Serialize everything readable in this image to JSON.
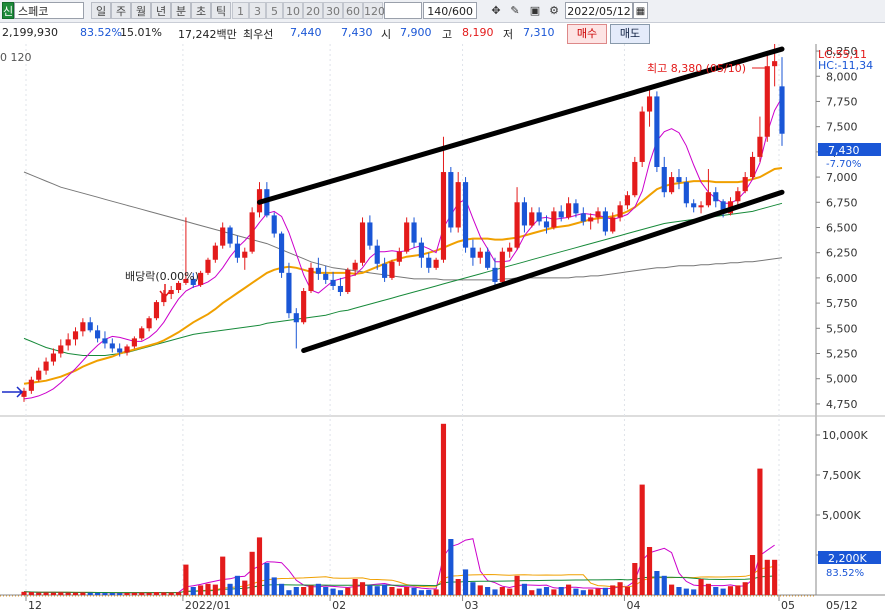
{
  "toolbar": {
    "market_badge": "신",
    "stock_name": "스페코",
    "periods": [
      "일",
      "주",
      "월",
      "년",
      "분",
      "초",
      "틱"
    ],
    "active_period": "일",
    "intervals": [
      "1",
      "3",
      "5",
      "10",
      "20",
      "30",
      "60",
      "120"
    ],
    "count_value": "140/600",
    "date_value": "2022/05/12"
  },
  "infobar": {
    "volume": "2,199,930",
    "volume_ratio": "83.52%",
    "turnover": "15.01%",
    "trade_value": "17,242백만",
    "best_bid_label": "최우선",
    "best_ask": "7,440",
    "best_bid": "7,430",
    "open_label": "시",
    "open": "7,900",
    "high_label": "고",
    "high": "8,190",
    "low_label": "저",
    "low": "7,310",
    "buy_label": "매수",
    "sell_label": "매도"
  },
  "chart": {
    "ma_legend": "0  120",
    "lc_label": "LC:55,11",
    "hc_label": "HC:-11,34",
    "high_annotation": "최고 8,380 (05/10)",
    "dividend_annotation": "배당락(0.00%)",
    "current_price_badge": "7,430",
    "current_change": "-7.70%",
    "volume_badge": "2,200K",
    "volume_ratio_badge": "83.52%",
    "price_ticks": [
      "8,250",
      "8,000",
      "7,750",
      "7,500",
      "7,250",
      "7,000",
      "6,750",
      "6,500",
      "6,250",
      "6,000",
      "5,750",
      "5,500",
      "5,250",
      "5,000",
      "4,750"
    ],
    "volume_ticks": [
      "10,000K",
      "7,500K",
      "5,000K",
      "2,500K"
    ],
    "date_labels": [
      "12",
      "2022/01",
      "02",
      "03",
      "04",
      "05",
      "05/12"
    ],
    "colors": {
      "up": "#e31b1b",
      "down": "#1a56d6",
      "ma5": "#cc00cc",
      "ma10": "#1a2cc8",
      "ma20": "#f0a000",
      "ma60": "#178a3a",
      "ma120": "#777777"
    }
  },
  "chart_data": {
    "type": "candlestick",
    "y_range": [
      4650,
      8320
    ],
    "volume_range": [
      0,
      11000
    ],
    "candles": [
      [
        4820,
        4910,
        4770,
        4880
      ],
      [
        4880,
        5020,
        4850,
        4990
      ],
      [
        4990,
        5110,
        4970,
        5080
      ],
      [
        5080,
        5210,
        5040,
        5170
      ],
      [
        5170,
        5300,
        5130,
        5250
      ],
      [
        5250,
        5390,
        5210,
        5330
      ],
      [
        5330,
        5450,
        5280,
        5390
      ],
      [
        5390,
        5510,
        5330,
        5470
      ],
      [
        5470,
        5600,
        5420,
        5560
      ],
      [
        5560,
        5610,
        5460,
        5480
      ],
      [
        5480,
        5530,
        5360,
        5400
      ],
      [
        5400,
        5470,
        5300,
        5350
      ],
      [
        5350,
        5400,
        5260,
        5300
      ],
      [
        5300,
        5350,
        5220,
        5260
      ],
      [
        5260,
        5340,
        5230,
        5320
      ],
      [
        5320,
        5420,
        5300,
        5400
      ],
      [
        5400,
        5520,
        5380,
        5500
      ],
      [
        5500,
        5620,
        5470,
        5600
      ],
      [
        5600,
        5780,
        5580,
        5760
      ],
      [
        5760,
        5880,
        5720,
        5840
      ],
      [
        5840,
        5920,
        5790,
        5880
      ],
      [
        5880,
        5970,
        5850,
        5950
      ],
      [
        5950,
        6600,
        5930,
        5990
      ],
      [
        5990,
        6050,
        5900,
        5930
      ],
      [
        5930,
        6070,
        5910,
        6050
      ],
      [
        6050,
        6200,
        6030,
        6180
      ],
      [
        6180,
        6350,
        6150,
        6320
      ],
      [
        6320,
        6550,
        6290,
        6500
      ],
      [
        6500,
        6520,
        6300,
        6340
      ],
      [
        6340,
        6420,
        6150,
        6200
      ],
      [
        6200,
        6300,
        6080,
        6260
      ],
      [
        6260,
        6700,
        6240,
        6650
      ],
      [
        6650,
        6950,
        6600,
        6880
      ],
      [
        6880,
        6950,
        6600,
        6620
      ],
      [
        6620,
        6650,
        6400,
        6440
      ],
      [
        6440,
        6460,
        6000,
        6050
      ],
      [
        6050,
        6150,
        5600,
        5650
      ],
      [
        5650,
        5700,
        5300,
        5560
      ],
      [
        5560,
        5900,
        5540,
        5870
      ],
      [
        5870,
        6150,
        5850,
        6100
      ],
      [
        6100,
        6200,
        5980,
        6040
      ],
      [
        6040,
        6120,
        5940,
        5980
      ],
      [
        5980,
        6060,
        5880,
        5920
      ],
      [
        5920,
        6000,
        5820,
        5860
      ],
      [
        5860,
        6100,
        5840,
        6080
      ],
      [
        6080,
        6180,
        6020,
        6150
      ],
      [
        6150,
        6600,
        6120,
        6550
      ],
      [
        6550,
        6620,
        6280,
        6320
      ],
      [
        6320,
        6380,
        6080,
        6140
      ],
      [
        6140,
        6200,
        5960,
        6000
      ],
      [
        6000,
        6180,
        5980,
        6160
      ],
      [
        6160,
        6300,
        6120,
        6260
      ],
      [
        6260,
        6600,
        6240,
        6550
      ],
      [
        6550,
        6600,
        6300,
        6350
      ],
      [
        6350,
        6400,
        6100,
        6200
      ],
      [
        6200,
        6250,
        6050,
        6100
      ],
      [
        6100,
        6200,
        6080,
        6180
      ],
      [
        6180,
        7400,
        6150,
        7050
      ],
      [
        7050,
        7100,
        6450,
        6500
      ],
      [
        6500,
        7050,
        6450,
        6950
      ],
      [
        6950,
        7000,
        6250,
        6300
      ],
      [
        6300,
        6380,
        6120,
        6200
      ],
      [
        6200,
        6300,
        6140,
        6260
      ],
      [
        6260,
        6300,
        6080,
        6100
      ],
      [
        6100,
        6200,
        5900,
        5960
      ],
      [
        5960,
        6300,
        5940,
        6260
      ],
      [
        6260,
        6350,
        6200,
        6300
      ],
      [
        6300,
        6900,
        6280,
        6750
      ],
      [
        6750,
        6800,
        6450,
        6520
      ],
      [
        6520,
        6700,
        6500,
        6650
      ],
      [
        6650,
        6700,
        6520,
        6560
      ],
      [
        6560,
        6620,
        6440,
        6500
      ],
      [
        6500,
        6700,
        6480,
        6660
      ],
      [
        6660,
        6720,
        6560,
        6600
      ],
      [
        6600,
        6800,
        6580,
        6740
      ],
      [
        6740,
        6780,
        6600,
        6640
      ],
      [
        6640,
        6700,
        6520,
        6560
      ],
      [
        6560,
        6640,
        6480,
        6600
      ],
      [
        6600,
        6700,
        6540,
        6660
      ],
      [
        6660,
        6700,
        6420,
        6460
      ],
      [
        6460,
        6650,
        6440,
        6600
      ],
      [
        6600,
        6760,
        6560,
        6720
      ],
      [
        6720,
        6860,
        6680,
        6820
      ],
      [
        6820,
        7200,
        6800,
        7150
      ],
      [
        7150,
        7700,
        7100,
        7650
      ],
      [
        7650,
        7900,
        7500,
        7800
      ],
      [
        7800,
        7850,
        7050,
        7100
      ],
      [
        7100,
        7200,
        6800,
        6850
      ],
      [
        6850,
        7050,
        6830,
        7000
      ],
      [
        7000,
        7080,
        6880,
        6950
      ],
      [
        6950,
        7000,
        6700,
        6740
      ],
      [
        6740,
        6780,
        6650,
        6700
      ],
      [
        6700,
        6760,
        6640,
        6720
      ],
      [
        6720,
        7080,
        6700,
        6850
      ],
      [
        6850,
        6900,
        6700,
        6760
      ],
      [
        6760,
        6780,
        6600,
        6640
      ],
      [
        6640,
        6800,
        6620,
        6760
      ],
      [
        6760,
        6900,
        6720,
        6860
      ],
      [
        6860,
        7050,
        6840,
        7000
      ],
      [
        7000,
        7250,
        6980,
        7200
      ],
      [
        7200,
        7600,
        7150,
        7400
      ],
      [
        7400,
        8250,
        7350,
        8100
      ],
      [
        8100,
        8380,
        7900,
        8150
      ],
      [
        7900,
        8190,
        7310,
        7430
      ]
    ],
    "volumes": [
      200,
      180,
      150,
      160,
      150,
      170,
      150,
      150,
      160,
      140,
      130,
      120,
      120,
      110,
      130,
      140,
      150,
      140,
      180,
      160,
      150,
      170,
      1900,
      500,
      600,
      700,
      650,
      2400,
      700,
      1200,
      900,
      2700,
      3600,
      2000,
      1100,
      700,
      300,
      500,
      500,
      600,
      700,
      500,
      400,
      300,
      450,
      1000,
      800,
      600,
      550,
      650,
      500,
      400,
      500,
      450,
      300,
      320,
      350,
      10700,
      3500,
      1000,
      1600,
      800,
      600,
      500,
      350,
      500,
      400,
      1200,
      700,
      300,
      400,
      500,
      350,
      500,
      650,
      400,
      300,
      350,
      400,
      450,
      600,
      800,
      500,
      2000,
      6900,
      3000,
      1500,
      1200,
      650,
      500,
      400,
      350,
      1000,
      700,
      500,
      400,
      550,
      600,
      800,
      2500,
      7900,
      2200,
      2200
    ],
    "ma5": [
      4800,
      4810,
      4830,
      4860,
      4900,
      4960,
      5030,
      5100,
      5180,
      5260,
      5330,
      5390,
      5420,
      5410,
      5390,
      5370,
      5370,
      5410,
      5470,
      5560,
      5680,
      5790,
      5870,
      5910,
      5930,
      5960,
      6010,
      6100,
      6210,
      6300,
      6370,
      6450,
      6550,
      6640,
      6660,
      6610,
      6450,
      6240,
      6030,
      5880,
      5850,
      5910,
      5970,
      5990,
      6010,
      6030,
      6100,
      6200,
      6260,
      6260,
      6270,
      6260,
      6270,
      6300,
      6320,
      6290,
      6250,
      6500,
      6620,
      6740,
      6780,
      6590,
      6410,
      6290,
      6160,
      6160,
      6170,
      6280,
      6420,
      6510,
      6590,
      6600,
      6580,
      6590,
      6600,
      6620,
      6640,
      6630,
      6620,
      6600,
      6580,
      6600,
      6630,
      6700,
      6860,
      7140,
      7360,
      7450,
      7480,
      7440,
      7310,
      7120,
      6950,
      6850,
      6790,
      6740,
      6740,
      6780,
      6860,
      6980,
      7140,
      7440,
      7660,
      7790
    ],
    "ma20": [
      4950,
      4960,
      4970,
      4980,
      5000,
      5020,
      5050,
      5080,
      5120,
      5150,
      5180,
      5200,
      5220,
      5250,
      5270,
      5290,
      5310,
      5330,
      5350,
      5380,
      5420,
      5460,
      5510,
      5560,
      5600,
      5640,
      5690,
      5750,
      5800,
      5850,
      5900,
      5950,
      6000,
      6050,
      6080,
      6100,
      6110,
      6100,
      6080,
      6060,
      6050,
      6050,
      6050,
      6050,
      6050,
      6040,
      6050,
      6080,
      6110,
      6140,
      6170,
      6190,
      6210,
      6220,
      6230,
      6250,
      6270,
      6300,
      6330,
      6360,
      6380,
      6390,
      6390,
      6390,
      6380,
      6380,
      6390,
      6400,
      6420,
      6440,
      6460,
      6480,
      6500,
      6510,
      6520,
      6540,
      6560,
      6580,
      6590,
      6600,
      6610,
      6630,
      6660,
      6700,
      6760,
      6820,
      6880,
      6910,
      6930,
      6940,
      6950,
      6960,
      6960,
      6960,
      6950,
      6950,
      6950,
      6950,
      6960,
      6980,
      7000,
      7040,
      7080,
      7090
    ],
    "ma60": [
      5400,
      5370,
      5340,
      5310,
      5290,
      5270,
      5250,
      5240,
      5230,
      5230,
      5230,
      5230,
      5240,
      5250,
      5260,
      5280,
      5300,
      5320,
      5340,
      5360,
      5380,
      5400,
      5420,
      5440,
      5450,
      5460,
      5470,
      5480,
      5490,
      5500,
      5510,
      5520,
      5530,
      5550,
      5560,
      5570,
      5580,
      5590,
      5600,
      5610,
      5620,
      5630,
      5650,
      5670,
      5680,
      5700,
      5720,
      5740,
      5760,
      5780,
      5800,
      5820,
      5840,
      5860,
      5880,
      5900,
      5920,
      5940,
      5960,
      5980,
      6000,
      6020,
      6040,
      6060,
      6080,
      6100,
      6120,
      6140,
      6160,
      6180,
      6200,
      6220,
      6240,
      6260,
      6280,
      6300,
      6320,
      6340,
      6360,
      6380,
      6400,
      6420,
      6440,
      6460,
      6480,
      6500,
      6520,
      6540,
      6550,
      6560,
      6570,
      6580,
      6590,
      6600,
      6610,
      6620,
      6630,
      6640,
      6650,
      6660,
      6680,
      6700,
      6720,
      6740
    ],
    "ma120": [
      7050,
      7020,
      6990,
      6960,
      6930,
      6900,
      6880,
      6860,
      6840,
      6820,
      6800,
      6780,
      6760,
      6740,
      6720,
      6700,
      6680,
      6660,
      6640,
      6620,
      6600,
      6580,
      6560,
      6540,
      6520,
      6500,
      6480,
      6460,
      6440,
      6420,
      6400,
      6380,
      6360,
      6340,
      6310,
      6280,
      6250,
      6220,
      6190,
      6160,
      6140,
      6120,
      6100,
      6090,
      6080,
      6070,
      6060,
      6050,
      6040,
      6030,
      6020,
      6010,
      6000,
      5990,
      5990,
      5990,
      5990,
      5980,
      5980,
      5980,
      5980,
      5980,
      5980,
      5980,
      5980,
      5990,
      5990,
      6000,
      6000,
      6000,
      6000,
      6000,
      6000,
      6000,
      6000,
      6010,
      6010,
      6020,
      6020,
      6030,
      6040,
      6050,
      6060,
      6070,
      6080,
      6090,
      6100,
      6100,
      6110,
      6120,
      6120,
      6120,
      6130,
      6130,
      6140,
      6140,
      6150,
      6150,
      6160,
      6160,
      6170,
      6180,
      6190,
      6200
    ],
    "trend_lines": {
      "upper_channel": [
        [
          32,
          6750
        ],
        [
          103,
          8270
        ]
      ],
      "lower_channel": [
        [
          38,
          5280
        ],
        [
          103,
          6850
        ]
      ]
    }
  }
}
